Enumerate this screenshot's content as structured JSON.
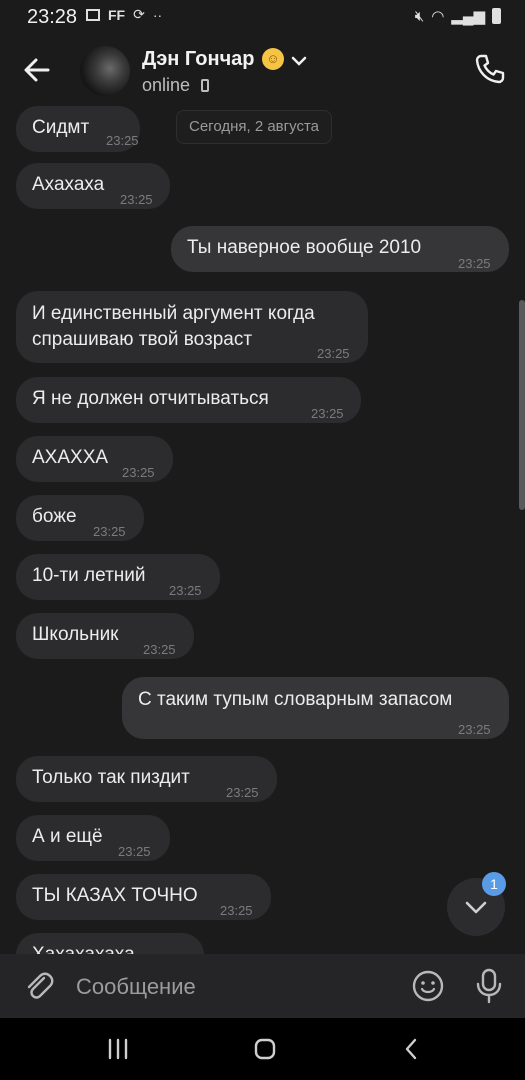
{
  "status_bar": {
    "time": "23:28",
    "ff_label": "FF"
  },
  "header": {
    "contact_name": "Дэн Гончар",
    "emoji": "☺",
    "status": "online"
  },
  "date_separator": "Сегодня, 2 августа",
  "messages": [
    {
      "text": "Сидмт",
      "time": "23:25",
      "direction": "in"
    },
    {
      "text": "Ахахаха",
      "time": "23:25",
      "direction": "in"
    },
    {
      "text": "Ты наверное вообще 2010",
      "time": "23:25",
      "direction": "out"
    },
    {
      "text_lines": [
        "И единственный аргумент когда",
        "спрашиваю твой возраст"
      ],
      "time": "23:25",
      "direction": "in"
    },
    {
      "text": "Я не должен отчитываться",
      "time": "23:25",
      "direction": "in"
    },
    {
      "text": "АХАХХА",
      "time": "23:25",
      "direction": "in"
    },
    {
      "text": "боже",
      "time": "23:25",
      "direction": "in"
    },
    {
      "text": "10-ти летний",
      "time": "23:25",
      "direction": "in"
    },
    {
      "text": "Школьник",
      "time": "23:25",
      "direction": "in"
    },
    {
      "text": "С таким тупым словарным запасом",
      "time": "23:25",
      "direction": "out"
    },
    {
      "text": "Только так пиздит",
      "time": "23:25",
      "direction": "in"
    },
    {
      "text": "А и ещё",
      "time": "23:25",
      "direction": "in"
    },
    {
      "text": "ТЫ КАЗАХ ТОЧНО",
      "time": "23:25",
      "direction": "in"
    },
    {
      "text": "Хахахахаха",
      "time": "",
      "direction": "in"
    }
  ],
  "scroll_down": {
    "unread_count": "1"
  },
  "composer": {
    "placeholder": "Сообщение"
  },
  "colors": {
    "background": "#1b1b1c",
    "bubble_in": "#2c2c2e",
    "bubble_out": "#363638",
    "badge": "#5a9be6"
  },
  "icons": [
    "back-arrow-icon",
    "chevron-down-icon",
    "phone-icon",
    "paperclip-icon",
    "smile-icon",
    "microphone-icon",
    "chevron-down-icon",
    "recent-apps-icon",
    "home-icon",
    "back-icon"
  ]
}
